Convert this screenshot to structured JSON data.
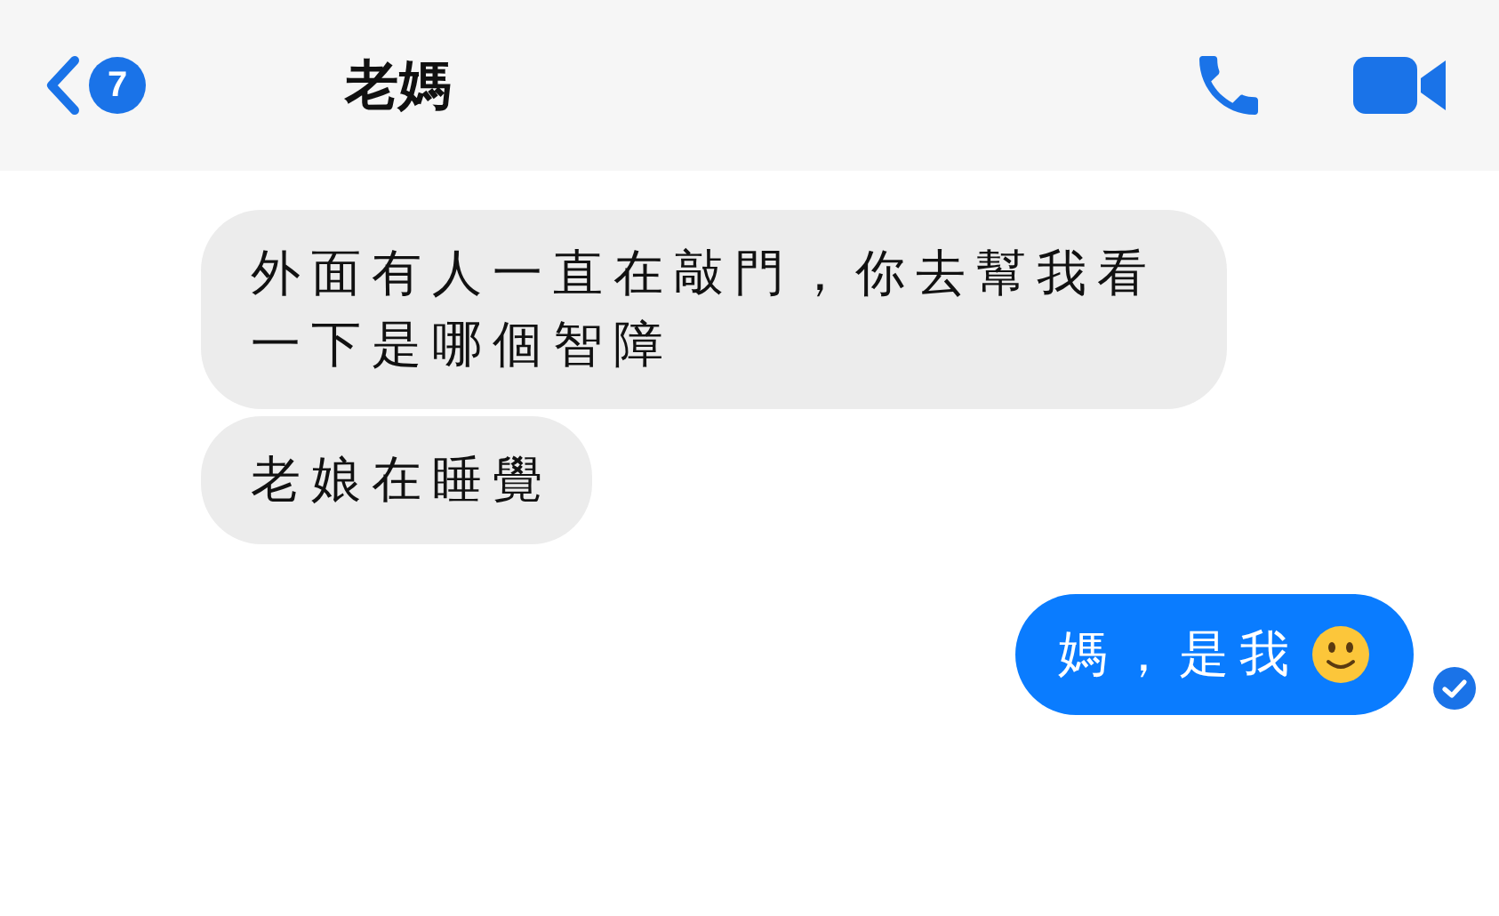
{
  "header": {
    "unread_count": "7",
    "title": "老媽"
  },
  "messages": [
    {
      "kind": "received",
      "text": "外面有人一直在敲門，你去幫我看一下是哪個智障"
    },
    {
      "kind": "received",
      "text": "老娘在睡覺"
    },
    {
      "kind": "sent",
      "text": "媽，是我",
      "emoji": true,
      "seen": true
    }
  ]
}
